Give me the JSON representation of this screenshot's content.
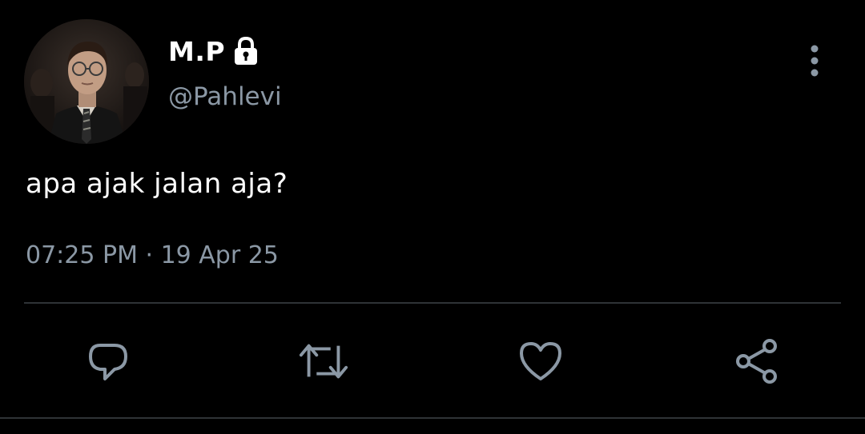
{
  "tweet": {
    "display_name": "M.P",
    "handle": "@Pahlevi",
    "text": "apa ajak jalan aja?",
    "timestamp": "07:25 PM · 19 Apr 25",
    "protected": true
  },
  "icons": {
    "lock": "lock-icon",
    "more": "more-vertical-icon",
    "reply": "reply-icon",
    "retweet": "retweet-icon",
    "like": "heart-icon",
    "share": "share-icon"
  },
  "colors": {
    "background": "#000000",
    "text_primary": "#ffffff",
    "text_secondary": "#8b98a5",
    "divider": "#2f3336",
    "icon": "#8b98a5"
  }
}
